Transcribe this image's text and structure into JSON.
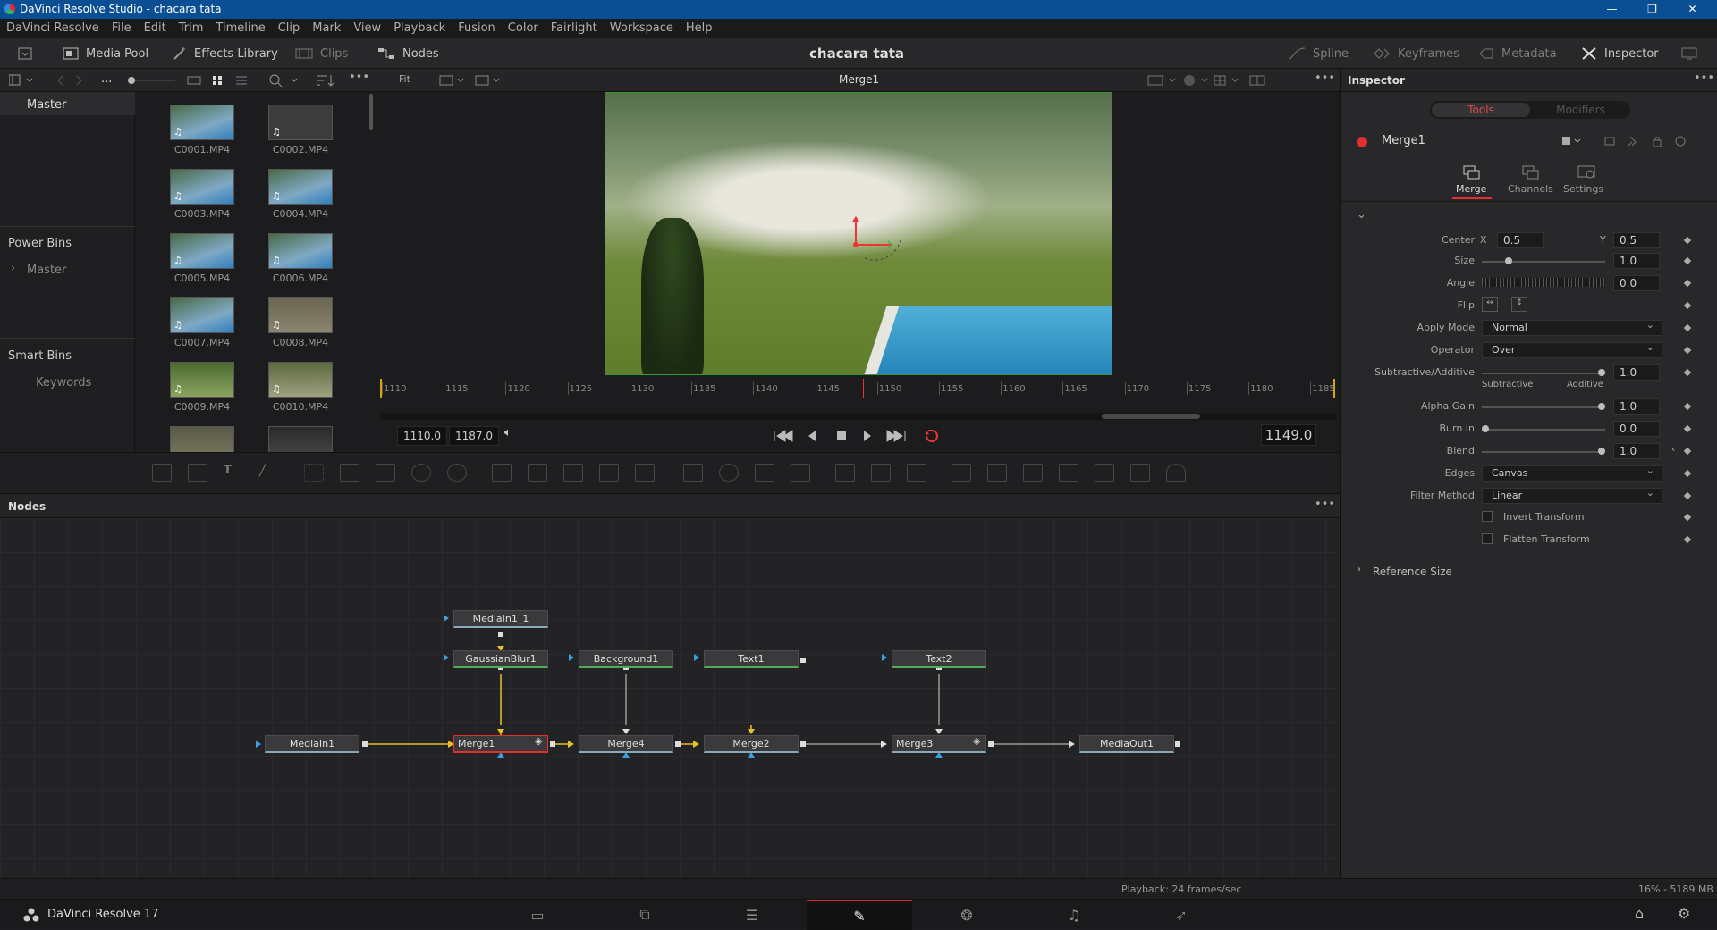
{
  "window": {
    "title": "DaVinci Resolve Studio - chacara tata"
  },
  "menu": [
    "DaVinci Resolve",
    "File",
    "Edit",
    "Trim",
    "Timeline",
    "Clip",
    "Mark",
    "View",
    "Playback",
    "Fusion",
    "Color",
    "Fairlight",
    "Workspace",
    "Help"
  ],
  "toolbar": {
    "media_pool": "Media Pool",
    "effects_library": "Effects Library",
    "clips": "Clips",
    "nodes": "Nodes",
    "project_title": "chacara tata",
    "spline": "Spline",
    "keyframes": "Keyframes",
    "metadata": "Metadata",
    "inspector": "Inspector"
  },
  "bins": {
    "master": "Master",
    "power_bins": "Power Bins",
    "power_master": "Master",
    "smart_bins": "Smart Bins",
    "keywords": "Keywords",
    "ellipsis": "..."
  },
  "clips": [
    "C0001.MP4",
    "C0002.MP4",
    "C0003.MP4",
    "C0004.MP4",
    "C0005.MP4",
    "C0006.MP4",
    "C0007.MP4",
    "C0008.MP4",
    "C0009.MP4",
    "C0010.MP4"
  ],
  "viewer": {
    "zoom": "Fit",
    "title": "Merge1",
    "ruler": [
      "1110",
      "1115",
      "1120",
      "1125",
      "1130",
      "1135",
      "1140",
      "1145",
      "1150",
      "1155",
      "1160",
      "1165",
      "1170",
      "1175",
      "1180",
      "1185"
    ],
    "playhead_frame": 1149,
    "range_start": 1110,
    "range_end": 1187,
    "in_point": "1110.0",
    "out_point": "1187.0",
    "current_frame": "1149.0"
  },
  "inspector": {
    "header": "Inspector",
    "tab_tools": "Tools",
    "tab_modifiers": "Modifiers",
    "node_name": "Merge1",
    "sub_merge": "Merge",
    "sub_channels": "Channels",
    "sub_settings": "Settings",
    "center_label": "Center",
    "x_label": "X",
    "center_x": "0.5",
    "y_label": "Y",
    "center_y": "0.5",
    "size_label": "Size",
    "size": "1.0",
    "size_fraction": 0.22,
    "angle_label": "Angle",
    "angle": "0.0",
    "flip_label": "Flip",
    "apply_mode_label": "Apply Mode",
    "apply_mode": "Normal",
    "operator_label": "Operator",
    "operator": "Over",
    "subadd_label": "Subtractive/Additive",
    "subadd": "1.0",
    "subtractive": "Subtractive",
    "additive": "Additive",
    "alpha_gain_label": "Alpha Gain",
    "alpha_gain": "1.0",
    "burn_in_label": "Burn In",
    "burn_in": "0.0",
    "blend_label": "Blend",
    "blend": "1.0",
    "edges_label": "Edges",
    "edges": "Canvas",
    "filter_label": "Filter Method",
    "filter": "Linear",
    "invert_transform": "Invert Transform",
    "flatten_transform": "Flatten Transform",
    "reference_size": "Reference Size"
  },
  "nodes": {
    "header": "Nodes",
    "list": {
      "mediain1_1": "MediaIn1_1",
      "gaussianblur1": "GaussianBlur1",
      "background1": "Background1",
      "text1": "Text1",
      "text2": "Text2",
      "mediain1": "MediaIn1",
      "merge1": "Merge1",
      "merge4": "Merge4",
      "merge2": "Merge2",
      "merge3": "Merge3",
      "mediaout1": "MediaOut1"
    }
  },
  "status": {
    "playback": "Playback: 24 frames/sec",
    "memory": "16% - 5189 MB",
    "app": "DaVinci Resolve 17"
  },
  "colors": {
    "accent": "#e03030",
    "title_bar": "#0a4f94",
    "link_yellow": "#e6c229",
    "link_white": "#dddddd"
  }
}
